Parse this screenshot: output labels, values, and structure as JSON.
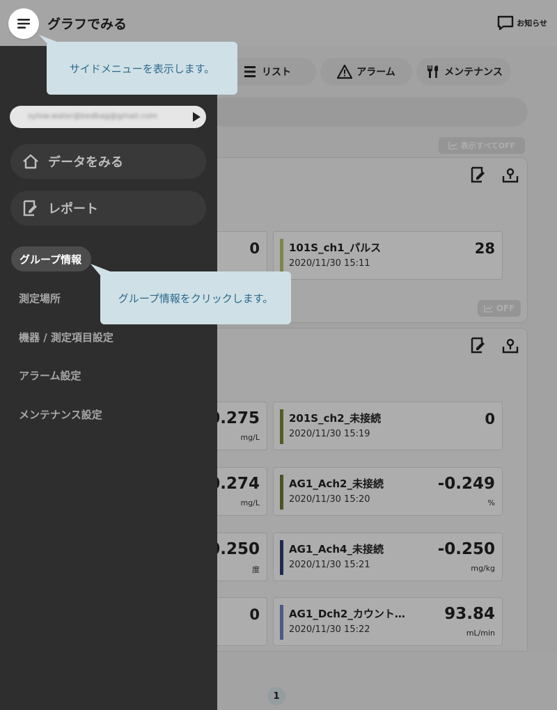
{
  "header": {
    "title": "グラフでみる",
    "notice_label": "お知らせ"
  },
  "tabs": [
    {
      "label": "リスト",
      "icon": "list-icon"
    },
    {
      "label": "アラーム",
      "icon": "warning-icon"
    },
    {
      "label": "メンテナンス",
      "icon": "tools-icon"
    }
  ],
  "toolbar": {
    "all_off_label": "表示すべてOFF",
    "group_off_label": "OFF"
  },
  "cards": [
    {
      "value": "0",
      "unit": ""
    },
    {
      "name": "101S_ch1_パルス",
      "time": "2020/11/30 15:11",
      "value": "28",
      "unit": "",
      "color": "#b9c56e"
    },
    {
      "value": "0.275",
      "unit": "mg/L"
    },
    {
      "name": "201S_ch2_未接続",
      "time": "2020/11/30 15:19",
      "value": "0",
      "unit": "",
      "color": "#7a8a38"
    },
    {
      "value": "0.274",
      "unit": "mg/L"
    },
    {
      "name": "AG1_Ach2_未接続",
      "time": "2020/11/30 15:20",
      "value": "-0.249",
      "unit": "%",
      "color": "#6e7d34"
    },
    {
      "value": "0.250",
      "unit": "度"
    },
    {
      "name": "AG1_Ach4_未接続",
      "time": "2020/11/30 15:21",
      "value": "-0.250",
      "unit": "mg/kg",
      "color": "#2e3f72"
    },
    {
      "value": "0",
      "unit": ""
    },
    {
      "name": "AG1_Dch2_カウント…",
      "time": "2020/11/30 15:22",
      "value": "93.84",
      "unit": "mL/min",
      "color": "#6f86c4"
    }
  ],
  "pagination": {
    "current": "1"
  },
  "side_menu": {
    "email": "sylow.water@bedbag@gmail.com",
    "nav": [
      {
        "label": "データをみる",
        "icon": "home-icon"
      },
      {
        "label": "レポート",
        "icon": "report-icon"
      }
    ],
    "items": [
      {
        "label": "グループ情報",
        "active": true
      },
      {
        "label": "測定場所"
      },
      {
        "label": "機器 / 測定項目設定"
      },
      {
        "label": "アラーム設定"
      },
      {
        "label": "メンテナンス設定"
      }
    ]
  },
  "tooltips": {
    "menu": "サイドメニューを表示します。",
    "group": "グループ情報をクリックします。"
  }
}
